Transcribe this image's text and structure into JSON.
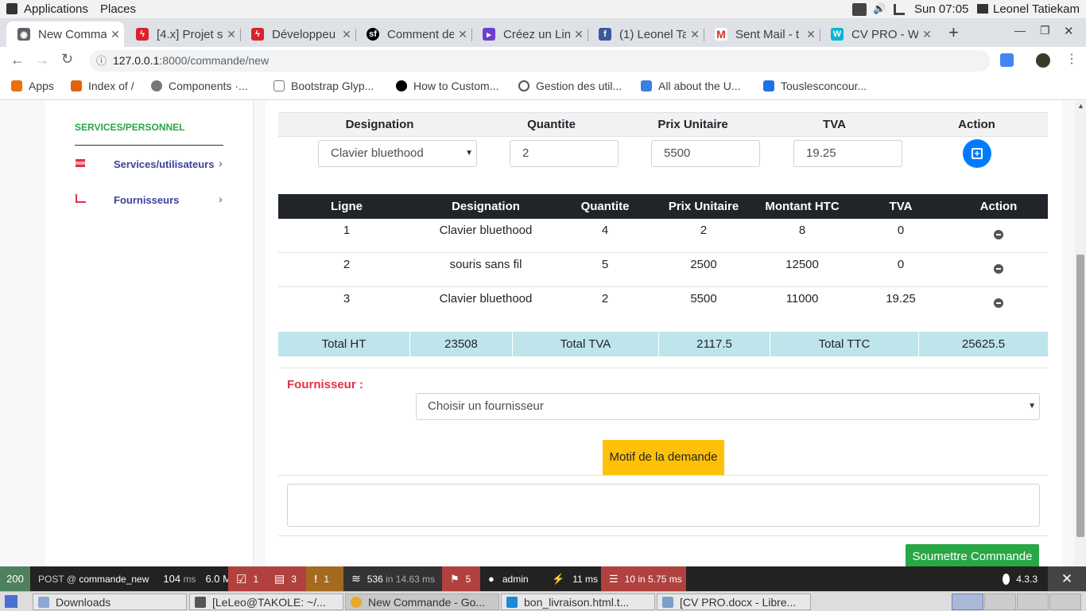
{
  "topbar": {
    "applications": "Applications",
    "places": "Places",
    "time": "Sun 07:05",
    "user": "Leonel Tatiekam"
  },
  "tabs": [
    {
      "title": "New Commande",
      "color": "#e44d26",
      "active": true
    },
    {
      "title": "[4.x] Projet s",
      "color": "#d9232d"
    },
    {
      "title": "Développeu",
      "color": "#d9232d"
    },
    {
      "title": "Comment de",
      "color": "#000000"
    },
    {
      "title": "Créez un Lin",
      "color": "#6c3fd1"
    },
    {
      "title": "(1) Leonel Ta",
      "color": "#3b5998"
    },
    {
      "title": "Sent Mail - t",
      "color": "#d93025"
    },
    {
      "title": "CV PRO - W",
      "color": "#00b5d1"
    }
  ],
  "address": {
    "host": "127.0.0.1",
    "path": ":8000/commande/new"
  },
  "bookmarks": [
    "Apps",
    "Index of /",
    "Components ·...",
    "Bootstrap Glyp...",
    "How to Custom...",
    "Gestion des util...",
    "All about the U...",
    "Touslesconcour..."
  ],
  "sidebar": {
    "section": "SERVICES/PERSONNEL",
    "items": [
      "Services/utilisateurs",
      "Fournisseurs"
    ]
  },
  "form_row": {
    "headers": [
      "Designation",
      "Quantite",
      "Prix Unitaire",
      "TVA",
      "Action"
    ],
    "designation": "Clavier bluethood",
    "quantite": "2",
    "prix": "5500",
    "tva": "19.25"
  },
  "lines": {
    "headers": [
      "Ligne",
      "Designation",
      "Quantite",
      "Prix Unitaire",
      "Montant HTC",
      "TVA",
      "Action"
    ],
    "rows": [
      [
        "1",
        "Clavier bluethood",
        "4",
        "2",
        "8",
        "0"
      ],
      [
        "2",
        "souris sans fil",
        "5",
        "2500",
        "12500",
        "0"
      ],
      [
        "3",
        "Clavier bluethood",
        "2",
        "5500",
        "11000",
        "19.25"
      ]
    ]
  },
  "totals": [
    "Total HT",
    "23508",
    "Total TVA",
    "2117.5",
    "Total TTC",
    "25625.5"
  ],
  "fournisseur": {
    "label": "Fournisseur :",
    "placeholder": "Choisir un fournisseur"
  },
  "motif": "Motif de la demande",
  "submit": "Soumettre Commande",
  "sfbar": {
    "status": "200",
    "method": "POST @",
    "route": "commande_new",
    "time": "104",
    "time_unit": "ms",
    "memory": "6.0 MB",
    "forms": "1",
    "logs": "3",
    "warnings": "1",
    "twig": "536",
    "twig_in": "in 14.63 ms",
    "translations": "5",
    "user": "admin",
    "ajax": "11 ms",
    "db": "10 in 5.75 ms",
    "version": "4.3.3"
  },
  "taskbar": [
    "Downloads",
    "[LeLeo@TAKOLE: ~/...",
    "New Commande - Go...",
    "bon_livraison.html.t...",
    "[CV PRO.docx - Libre..."
  ]
}
